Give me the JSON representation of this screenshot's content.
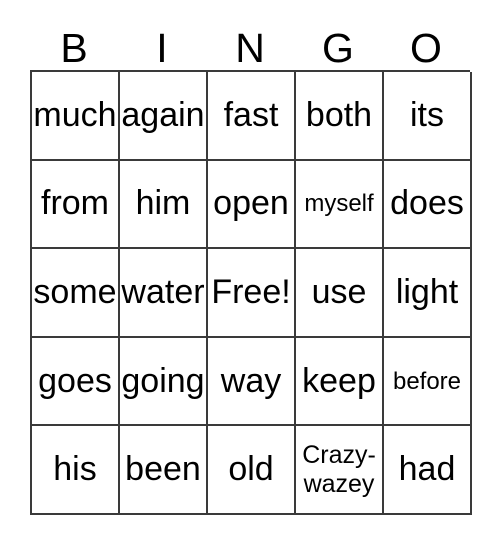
{
  "card": {
    "title": "BINGO",
    "columns": [
      "B",
      "I",
      "N",
      "G",
      "O"
    ],
    "free_space_label": "Free!",
    "colors": {
      "background": "#ffffff",
      "text": "#000000",
      "grid_line": "#3a3a3a"
    },
    "rows": [
      {
        "cells": [
          {
            "text": "much",
            "size": "normal"
          },
          {
            "text": "again",
            "size": "normal"
          },
          {
            "text": "fast",
            "size": "normal"
          },
          {
            "text": "both",
            "size": "normal"
          },
          {
            "text": "its",
            "size": "normal"
          }
        ]
      },
      {
        "cells": [
          {
            "text": "from",
            "size": "normal"
          },
          {
            "text": "him",
            "size": "normal"
          },
          {
            "text": "open",
            "size": "normal"
          },
          {
            "text": "myself",
            "size": "small"
          },
          {
            "text": "does",
            "size": "normal"
          }
        ]
      },
      {
        "cells": [
          {
            "text": "some",
            "size": "normal"
          },
          {
            "text": "water",
            "size": "normal"
          },
          {
            "text": "Free!",
            "size": "normal"
          },
          {
            "text": "use",
            "size": "normal"
          },
          {
            "text": "light",
            "size": "normal"
          }
        ]
      },
      {
        "cells": [
          {
            "text": "goes",
            "size": "normal"
          },
          {
            "text": "going",
            "size": "normal"
          },
          {
            "text": "way",
            "size": "normal"
          },
          {
            "text": "keep",
            "size": "normal"
          },
          {
            "text": "before",
            "size": "small"
          }
        ]
      },
      {
        "cells": [
          {
            "text": "his",
            "size": "normal"
          },
          {
            "text": "been",
            "size": "normal"
          },
          {
            "text": "old",
            "size": "normal"
          },
          {
            "text": "Crazy-\nwazey",
            "size": "wrap"
          },
          {
            "text": "had",
            "size": "normal"
          }
        ]
      }
    ]
  }
}
